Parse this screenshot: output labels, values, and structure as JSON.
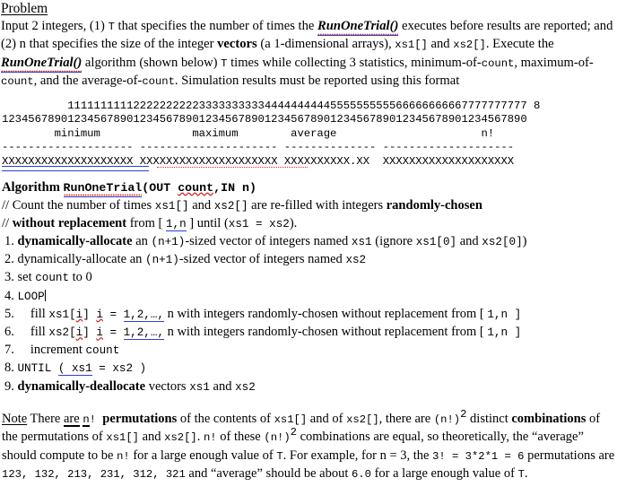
{
  "document": {
    "heading": "Problem",
    "intro": {
      "s1": "Input 2 integers, (1) ",
      "code_T": "T",
      "s2": " that specifies the number of times the ",
      "fn1": "RunOneTrial()",
      "s3": " executes before results are reported; and (2) n that specifies the size of the integer ",
      "bold_vectors": "vectors",
      "s4": " (a 1-dimensional arrays), ",
      "code_xs1": "xs1[]",
      "s5": " and ",
      "code_xs2": "xs2[]",
      "s6": ". Execute the ",
      "fn2": "RunOneTrial()",
      "s7": " algorithm (shown below) ",
      "code_T2": "T",
      "s8": " times while collecting 3 statistics, minimum-of-",
      "code_count1": "count",
      "s9": ", maximum-of-",
      "code_count2": "count",
      "s10": ", and the average-of-",
      "code_count3": "count",
      "s11": ". Simulation results must be reported using this format"
    },
    "format_block": {
      "ruler_tens": "          1111111111222222222233333333334444444444555555555566666666667777777777 8",
      "ruler_ones": "12345678901234567890123456789012345678901234567890123456789012345678901234567890",
      "header_row": "        minimum              maximum        average                      n!",
      "dashes_row": "-------------------- --------------------- -------------- --------------------",
      "x_row_1": "XXXXXXXXXXXXXXXXXXXX",
      "x_gap_1": " ",
      "x_row_2": "XXXXXXXXXXXXXXXXXXXXX",
      "x_gap_2": " ",
      "x_row_3": "XXXXXXXXXX.XX",
      "x_gap_3": "  ",
      "x_row_4": "XXXXXXXXXXXXXXXXXXXX"
    },
    "algorithm": {
      "title_word": "Algorithm",
      "title_fn": "RunOneTrial",
      "title_open": "(",
      "title_out": "OUT ",
      "title_count": "count",
      "title_rest": ",IN n)",
      "comment1_slashes": "// ",
      "comment1_a": "Count the number of times ",
      "comment1_xs1": "xs1[]",
      "comment1_b": " and ",
      "comment1_xs2": "xs2[]",
      "comment1_c": " are re-filled with integers ",
      "comment1_bold": "randomly-chosen",
      "comment2_slashes": "//   ",
      "comment2_bold": "without replacement",
      "comment2_a": " from [ ",
      "comment2_range": "1,n",
      "comment2_b": " ] until (",
      "comment2_xs1": "xs1 = xs2",
      "comment2_c": ").",
      "steps": [
        {
          "num": "1.",
          "bold": "dynamically-allocate",
          "a": " an ",
          "code1": "(n+1)",
          "b": "-sized vector of integers named ",
          "code2": "xs1",
          "c": " (ignore ",
          "code3": "xs1[0]",
          "d": " and ",
          "code4": "xs2[0]",
          "e": ")"
        },
        {
          "num": "2.",
          "plain": "dynamically-allocate",
          "a": " an ",
          "code1": "(n+1)",
          "b": "-sized vector of integers named ",
          "code2": "xs2"
        },
        {
          "num": "3.",
          "a": "set ",
          "code1": "count",
          "b": " to 0"
        },
        {
          "num": "4.",
          "code1": "LOOP"
        },
        {
          "num": "5.",
          "a": "fill ",
          "code_arr": "xs1[",
          "code_i1": "i",
          "code_arr_close": "] ",
          "code_i2": "i",
          "code_eq": " = ",
          "range": "1,2,…,",
          "b": " n with integers randomly-chosen without replacement from [ ",
          "code_range": "1,n",
          "c": " ]"
        },
        {
          "num": "6.",
          "a": "fill ",
          "code_arr": "xs2[",
          "code_i1": "i",
          "code_arr_close": "] ",
          "code_i2": "i",
          "code_eq": " = ",
          "range": "1,2,…,",
          "b": " n with integers randomly-chosen without replacement from [ ",
          "code_range": "1,n",
          "c": " ]"
        },
        {
          "num": "7.",
          "a": "increment ",
          "code1": "count"
        },
        {
          "num": "8.",
          "code_until": "UNTIL ",
          "code_cond": "( xs1",
          "code_rest": " = xs2 )"
        },
        {
          "num": "9.",
          "bold": "dynamically-deallocate",
          "a": " vectors ",
          "code1": "xs1",
          "b": " and ",
          "code2": "xs2"
        }
      ]
    },
    "note": {
      "label": "Note",
      "n1": " There ",
      "are": "are",
      "n2": " ",
      "n_sym": "n",
      "n3": "! ",
      "bold1": "permutations",
      "n4": " of the contents of ",
      "code1": "xs1[]",
      "n5": " and of ",
      "code2": "xs2[]",
      "n6": ", there are ",
      "code3": "(n!)",
      "sup1": "2",
      "n7": " distinct ",
      "bold2": "combinations",
      "n8": " of the permutations of ",
      "code4": "xs1[]",
      "n9": " and ",
      "code5": "xs2[]",
      "n10": ". ",
      "code6": "n!",
      "n11": " of these ",
      "code7": "(n!)",
      "sup2": "2",
      "n12": " combinations are equal, so theoretically, the “average” should compute to be ",
      "code8": "n!",
      "n13": " for a large enough value of ",
      "code9": "T",
      "n14": ". For example, for n  = 3, the ",
      "code10": "3! = 3*2*1 = 6",
      "n15": " permutations are ",
      "code11": "123, 132, 213, 231, 312, 321",
      "n16": " and “average” should be about ",
      "code12": "6.0",
      "n17": " for a large enough value of ",
      "code13": "T",
      "n18": "."
    }
  },
  "colors": {
    "page_background": "#ffffff",
    "text": "#000000",
    "spellcheck_underline": "#d42a2a",
    "tracked_change_underline": "#2a3fd0",
    "smart_tag_underline": "#e03030"
  }
}
